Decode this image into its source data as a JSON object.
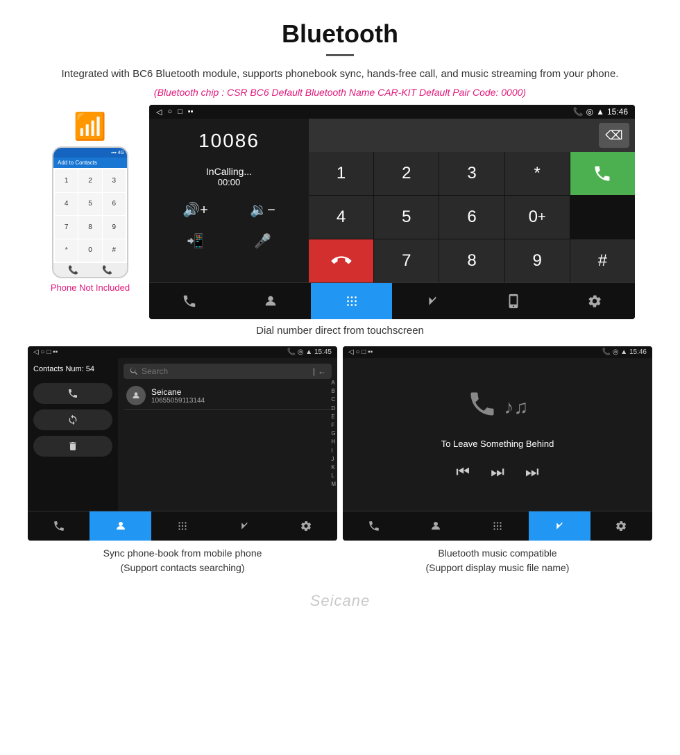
{
  "page": {
    "title": "Bluetooth",
    "subtitle": "Integrated with BC6 Bluetooth module, supports phonebook sync, hands-free call, and music streaming from your phone.",
    "bt_info": "(Bluetooth chip : CSR BC6    Default Bluetooth Name CAR-KIT    Default Pair Code: 0000)",
    "dial_caption": "Dial number direct from touchscreen",
    "left_caption_title": "Sync phone-book from mobile phone",
    "left_caption_sub": "(Support contacts searching)",
    "right_caption_title": "Bluetooth music compatible",
    "right_caption_sub": "(Support display music file name)",
    "phone_not_included": "Phone Not Included",
    "watermark": "Seicane"
  },
  "status_bar_main": {
    "back_icon": "◁",
    "home_icon": "○",
    "square_icon": "□",
    "notification_icon": "▪▪",
    "time": "15:46",
    "phone_icon": "📞",
    "location_icon": "◎",
    "wifi_icon": "▲"
  },
  "dial_screen": {
    "number": "10086",
    "call_status": "InCalling...",
    "timer": "00:00",
    "vol_up": "🔊+",
    "vol_down": "🔉",
    "transfer_icon": "📲",
    "mic_icon": "🎤",
    "keys": [
      "1",
      "2",
      "3",
      "*",
      "4",
      "5",
      "6",
      "0+",
      "7",
      "8",
      "9",
      "#"
    ],
    "call_green_icon": "📞",
    "call_red_icon": "📞"
  },
  "bottom_bar_main": {
    "items": [
      {
        "icon": "📞+",
        "active": false
      },
      {
        "icon": "👤",
        "active": false
      },
      {
        "icon": "⠿",
        "active": true
      },
      {
        "icon": "✱",
        "active": false
      },
      {
        "icon": "📲",
        "active": false
      },
      {
        "icon": "⚙",
        "active": false
      }
    ]
  },
  "contacts_screen": {
    "status_time": "15:45",
    "contacts_count": "Contacts Num: 54",
    "contact_name": "Seicane",
    "contact_number": "10655059113144",
    "search_placeholder": "Search",
    "alpha_list": [
      "A",
      "B",
      "C",
      "D",
      "E",
      "F",
      "G",
      "H",
      "I",
      "J",
      "K",
      "L",
      "M"
    ],
    "bottom_items": [
      {
        "icon": "📞",
        "active": false
      },
      {
        "icon": "👤",
        "active": true
      },
      {
        "icon": "⠿",
        "active": false
      },
      {
        "icon": "✱",
        "active": false
      },
      {
        "icon": "⚙",
        "active": false
      }
    ]
  },
  "music_screen": {
    "status_time": "15:46",
    "song_title": "To Leave Something Behind",
    "controls": [
      "⏮",
      "⏭",
      "⏭"
    ],
    "bottom_items": [
      {
        "icon": "📞",
        "active": false
      },
      {
        "icon": "👤",
        "active": false
      },
      {
        "icon": "⠿",
        "active": false
      },
      {
        "icon": "✱",
        "active": true
      },
      {
        "icon": "⚙",
        "active": false
      }
    ]
  },
  "phone_mock": {
    "header_text": "Add to Contacts",
    "keys": [
      "1",
      "2",
      "3",
      "4",
      "5",
      "6",
      "7",
      "8",
      "9",
      "*",
      "0",
      "#"
    ],
    "bottom_icons": [
      "📞",
      "📞"
    ]
  }
}
